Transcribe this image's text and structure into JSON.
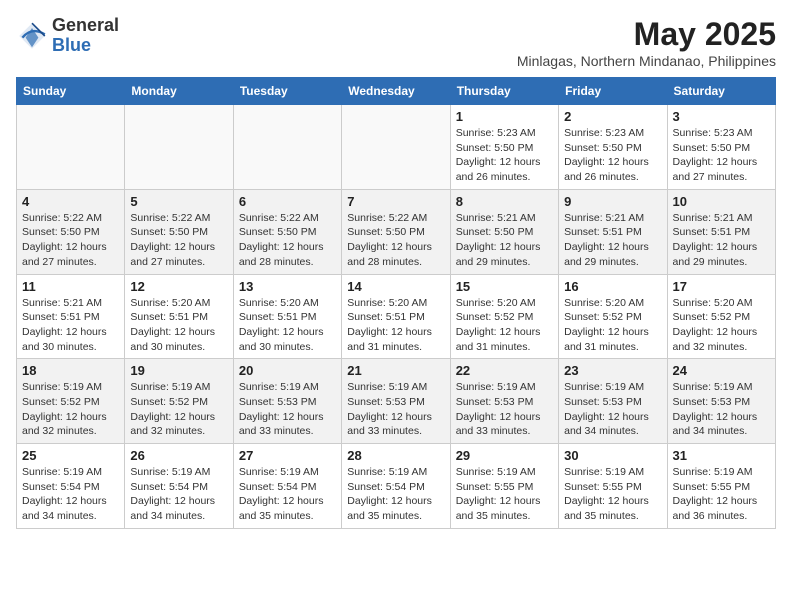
{
  "logo": {
    "general": "General",
    "blue": "Blue"
  },
  "title": {
    "month_year": "May 2025",
    "location": "Minlagas, Northern Mindanao, Philippines"
  },
  "weekdays": [
    "Sunday",
    "Monday",
    "Tuesday",
    "Wednesday",
    "Thursday",
    "Friday",
    "Saturday"
  ],
  "weeks": [
    [
      {
        "day": "",
        "detail": ""
      },
      {
        "day": "",
        "detail": ""
      },
      {
        "day": "",
        "detail": ""
      },
      {
        "day": "",
        "detail": ""
      },
      {
        "day": "1",
        "detail": "Sunrise: 5:23 AM\nSunset: 5:50 PM\nDaylight: 12 hours\nand 26 minutes."
      },
      {
        "day": "2",
        "detail": "Sunrise: 5:23 AM\nSunset: 5:50 PM\nDaylight: 12 hours\nand 26 minutes."
      },
      {
        "day": "3",
        "detail": "Sunrise: 5:23 AM\nSunset: 5:50 PM\nDaylight: 12 hours\nand 27 minutes."
      }
    ],
    [
      {
        "day": "4",
        "detail": "Sunrise: 5:22 AM\nSunset: 5:50 PM\nDaylight: 12 hours\nand 27 minutes."
      },
      {
        "day": "5",
        "detail": "Sunrise: 5:22 AM\nSunset: 5:50 PM\nDaylight: 12 hours\nand 27 minutes."
      },
      {
        "day": "6",
        "detail": "Sunrise: 5:22 AM\nSunset: 5:50 PM\nDaylight: 12 hours\nand 28 minutes."
      },
      {
        "day": "7",
        "detail": "Sunrise: 5:22 AM\nSunset: 5:50 PM\nDaylight: 12 hours\nand 28 minutes."
      },
      {
        "day": "8",
        "detail": "Sunrise: 5:21 AM\nSunset: 5:50 PM\nDaylight: 12 hours\nand 29 minutes."
      },
      {
        "day": "9",
        "detail": "Sunrise: 5:21 AM\nSunset: 5:51 PM\nDaylight: 12 hours\nand 29 minutes."
      },
      {
        "day": "10",
        "detail": "Sunrise: 5:21 AM\nSunset: 5:51 PM\nDaylight: 12 hours\nand 29 minutes."
      }
    ],
    [
      {
        "day": "11",
        "detail": "Sunrise: 5:21 AM\nSunset: 5:51 PM\nDaylight: 12 hours\nand 30 minutes."
      },
      {
        "day": "12",
        "detail": "Sunrise: 5:20 AM\nSunset: 5:51 PM\nDaylight: 12 hours\nand 30 minutes."
      },
      {
        "day": "13",
        "detail": "Sunrise: 5:20 AM\nSunset: 5:51 PM\nDaylight: 12 hours\nand 30 minutes."
      },
      {
        "day": "14",
        "detail": "Sunrise: 5:20 AM\nSunset: 5:51 PM\nDaylight: 12 hours\nand 31 minutes."
      },
      {
        "day": "15",
        "detail": "Sunrise: 5:20 AM\nSunset: 5:52 PM\nDaylight: 12 hours\nand 31 minutes."
      },
      {
        "day": "16",
        "detail": "Sunrise: 5:20 AM\nSunset: 5:52 PM\nDaylight: 12 hours\nand 31 minutes."
      },
      {
        "day": "17",
        "detail": "Sunrise: 5:20 AM\nSunset: 5:52 PM\nDaylight: 12 hours\nand 32 minutes."
      }
    ],
    [
      {
        "day": "18",
        "detail": "Sunrise: 5:19 AM\nSunset: 5:52 PM\nDaylight: 12 hours\nand 32 minutes."
      },
      {
        "day": "19",
        "detail": "Sunrise: 5:19 AM\nSunset: 5:52 PM\nDaylight: 12 hours\nand 32 minutes."
      },
      {
        "day": "20",
        "detail": "Sunrise: 5:19 AM\nSunset: 5:53 PM\nDaylight: 12 hours\nand 33 minutes."
      },
      {
        "day": "21",
        "detail": "Sunrise: 5:19 AM\nSunset: 5:53 PM\nDaylight: 12 hours\nand 33 minutes."
      },
      {
        "day": "22",
        "detail": "Sunrise: 5:19 AM\nSunset: 5:53 PM\nDaylight: 12 hours\nand 33 minutes."
      },
      {
        "day": "23",
        "detail": "Sunrise: 5:19 AM\nSunset: 5:53 PM\nDaylight: 12 hours\nand 34 minutes."
      },
      {
        "day": "24",
        "detail": "Sunrise: 5:19 AM\nSunset: 5:53 PM\nDaylight: 12 hours\nand 34 minutes."
      }
    ],
    [
      {
        "day": "25",
        "detail": "Sunrise: 5:19 AM\nSunset: 5:54 PM\nDaylight: 12 hours\nand 34 minutes."
      },
      {
        "day": "26",
        "detail": "Sunrise: 5:19 AM\nSunset: 5:54 PM\nDaylight: 12 hours\nand 34 minutes."
      },
      {
        "day": "27",
        "detail": "Sunrise: 5:19 AM\nSunset: 5:54 PM\nDaylight: 12 hours\nand 35 minutes."
      },
      {
        "day": "28",
        "detail": "Sunrise: 5:19 AM\nSunset: 5:54 PM\nDaylight: 12 hours\nand 35 minutes."
      },
      {
        "day": "29",
        "detail": "Sunrise: 5:19 AM\nSunset: 5:55 PM\nDaylight: 12 hours\nand 35 minutes."
      },
      {
        "day": "30",
        "detail": "Sunrise: 5:19 AM\nSunset: 5:55 PM\nDaylight: 12 hours\nand 35 minutes."
      },
      {
        "day": "31",
        "detail": "Sunrise: 5:19 AM\nSunset: 5:55 PM\nDaylight: 12 hours\nand 36 minutes."
      }
    ]
  ]
}
